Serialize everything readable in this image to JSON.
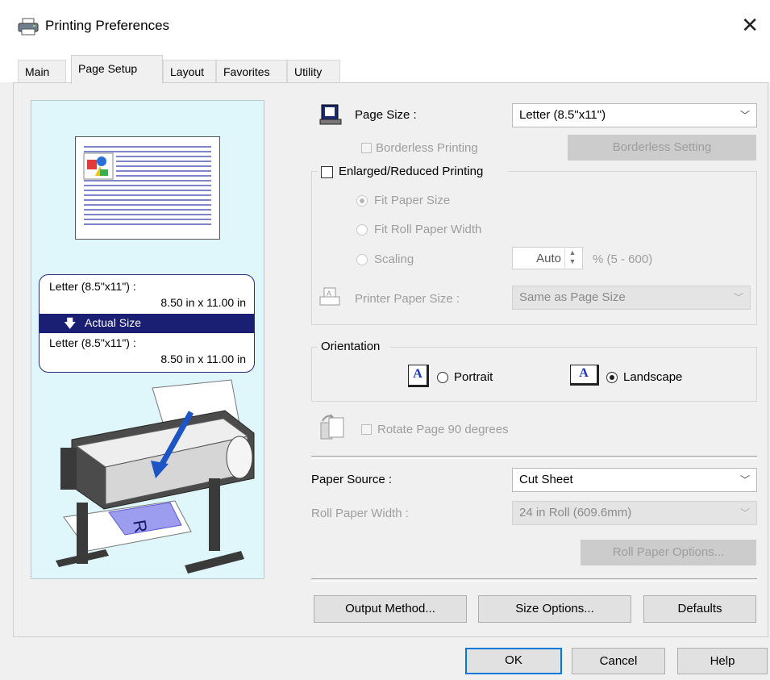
{
  "window": {
    "title": "Printing Preferences",
    "close_glyph": "✕",
    "icon": "printer-icon"
  },
  "tabs": [
    {
      "label": "Main"
    },
    {
      "label": "Page Setup",
      "active": true
    },
    {
      "label": "Layout"
    },
    {
      "label": "Favorites"
    },
    {
      "label": "Utility"
    }
  ],
  "preview": {
    "source_size": "Letter (8.5\"x11\") :",
    "source_dims": "8.50 in x 11.00 in",
    "scaling_label": "Actual Size",
    "output_size": "Letter (8.5\"x11\") :",
    "output_dims": "8.50 in x 11.00 in",
    "paper_letter": "R"
  },
  "page_size": {
    "label": "Page Size :",
    "value": "Letter (8.5\"x11\")"
  },
  "borderless": {
    "checkbox_label": "Borderless Printing",
    "checked": false,
    "button_label": "Borderless Setting"
  },
  "enlarged": {
    "checkbox_label": "Enlarged/Reduced Printing",
    "checked": false,
    "fit_paper": "Fit Paper Size",
    "fit_roll": "Fit Roll Paper Width",
    "scaling": "Scaling",
    "scaling_value": "Auto",
    "scaling_range": "% (5 - 600)",
    "printer_paper_size_label": "Printer Paper Size :",
    "printer_paper_size_value": "Same as Page Size"
  },
  "orientation": {
    "group_label": "Orientation",
    "portrait": "Portrait",
    "landscape": "Landscape",
    "selected": "Landscape",
    "icon_letter": "A"
  },
  "rotate": {
    "label": "Rotate Page 90 degrees",
    "checked": false
  },
  "paper_source": {
    "label": "Paper Source :",
    "value": "Cut Sheet"
  },
  "roll_width": {
    "label": "Roll Paper Width :",
    "value": "24 in Roll (609.6mm)",
    "options_button": "Roll Paper Options..."
  },
  "buttons": {
    "output_method": "Output Method...",
    "size_options": "Size Options...",
    "defaults": "Defaults",
    "ok": "OK",
    "cancel": "Cancel",
    "help": "Help"
  },
  "colors": {
    "accent": "#0078d7",
    "preview_bg": "#dff6fb",
    "actual_bar": "#1b1f74"
  }
}
